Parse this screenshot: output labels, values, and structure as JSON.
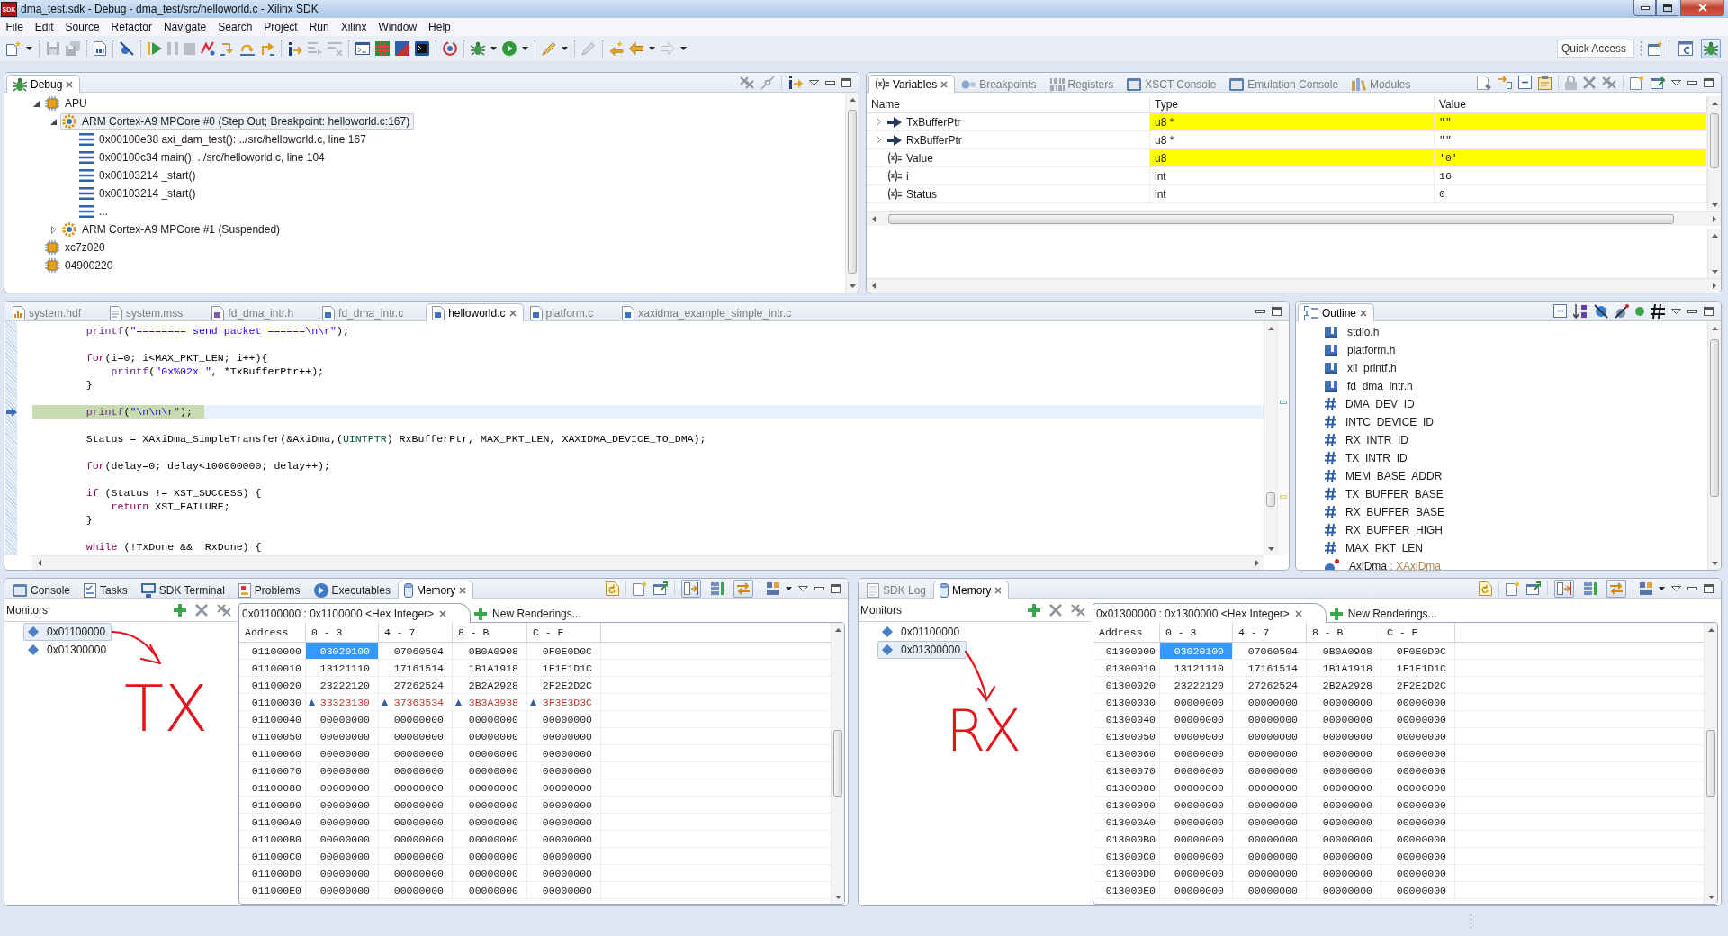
{
  "window": {
    "icon_text": "SDK",
    "title": "dma_test.sdk - Debug - dma_test/src/helloworld.c - Xilinx SDK"
  },
  "menu": [
    "File",
    "Edit",
    "Source",
    "Refactor",
    "Navigate",
    "Search",
    "Project",
    "Run",
    "Xilinx",
    "Window",
    "Help"
  ],
  "quick_access": {
    "placeholder": "Quick Access"
  },
  "perspectives": [
    {
      "kind": "cpp",
      "selected": false
    },
    {
      "kind": "debug",
      "selected": true
    }
  ],
  "debug_view": {
    "tab": "Debug",
    "tree": [
      {
        "label": "APU",
        "kind": "target",
        "expanded": true,
        "selected": false,
        "children": [
          {
            "label": "ARM Cortex-A9 MPCore #0 (Step Out; Breakpoint: helloworld.c:167)",
            "kind": "core",
            "expanded": true,
            "selected": true,
            "children": [
              {
                "label": "0x00100e38 axi_dam_test(): ../src/helloworld.c, line 167",
                "kind": "frame",
                "selected": false
              },
              {
                "label": "0x00100c34 main(): ../src/helloworld.c, line 104",
                "kind": "frame",
                "selected": false
              },
              {
                "label": "0x00103214 _start()",
                "kind": "frame",
                "selected": false
              },
              {
                "label": "0x00103214 _start()",
                "kind": "frame",
                "selected": false
              },
              {
                "label": "...",
                "kind": "frame",
                "selected": false
              }
            ]
          },
          {
            "label": "ARM Cortex-A9 MPCore #1 (Suspended)",
            "kind": "core",
            "expanded": false,
            "selected": false
          }
        ]
      },
      {
        "label": "xc7z020",
        "kind": "target",
        "selected": false
      },
      {
        "label": "04900220",
        "kind": "target",
        "selected": false
      }
    ]
  },
  "variables_view": {
    "focused": false,
    "tabs": [
      {
        "label": "Variables",
        "kind": "variables",
        "selected": true
      },
      {
        "label": "Breakpoints",
        "kind": "breakpoints",
        "selected": false
      },
      {
        "label": "Registers",
        "kind": "registers",
        "selected": false
      },
      {
        "label": "XSCT Console",
        "kind": "console",
        "selected": false
      },
      {
        "label": "Emulation Console",
        "kind": "console",
        "selected": false
      },
      {
        "label": "Modules",
        "kind": "modules",
        "selected": false
      }
    ],
    "columns": [
      "Name",
      "Type",
      "Value"
    ],
    "rows": [
      {
        "name": "TxBufferPtr",
        "type": "u8 *",
        "value": "\"\"",
        "kind": "pointer",
        "expanded": false,
        "changed": true
      },
      {
        "name": "RxBufferPtr",
        "type": "u8 *",
        "value": "\"\"",
        "kind": "pointer",
        "expanded": false,
        "changed": false
      },
      {
        "name": "Value",
        "type": "u8",
        "value": "'0'",
        "kind": "variable",
        "changed": true
      },
      {
        "name": "i",
        "type": "int",
        "value": "16",
        "kind": "variable",
        "changed": false
      },
      {
        "name": "Status",
        "type": "int",
        "value": "0",
        "kind": "variable",
        "changed": false
      }
    ]
  },
  "editor": {
    "focused": false,
    "tabs": [
      {
        "label": "system.hdf",
        "kind": "hdf",
        "selected": false
      },
      {
        "label": "system.mss",
        "kind": "mss",
        "selected": false
      },
      {
        "label": "fd_dma_intr.h",
        "kind": "h",
        "selected": false
      },
      {
        "label": "fd_dma_intr.c",
        "kind": "c",
        "selected": false
      },
      {
        "label": "helloworld.c",
        "kind": "c",
        "selected": true
      },
      {
        "label": "platform.c",
        "kind": "c",
        "selected": false
      },
      {
        "label": "xaxidma_example_simple_intr.c",
        "kind": "c",
        "selected": false
      }
    ],
    "lines": [
      {
        "current": false,
        "tokens": [
          {
            "text": "\t\tprintf",
            "kind": "function"
          },
          {
            "text": "(",
            "kind": "plain"
          },
          {
            "text": "\"======== send packet ======\\n\\r\"",
            "kind": "string"
          },
          {
            "text": ");",
            "kind": "plain"
          }
        ]
      },
      {
        "current": false
      },
      {
        "current": false,
        "tokens": [
          {
            "text": "\t\tfor",
            "kind": "keyword"
          },
          {
            "text": "(i=0; i<MAX_PKT_LEN; i++){",
            "kind": "plain"
          }
        ]
      },
      {
        "current": false,
        "tokens": [
          {
            "text": "\t\t\tprintf",
            "kind": "function"
          },
          {
            "text": "(",
            "kind": "plain"
          },
          {
            "text": "\"0x%02x \"",
            "kind": "string"
          },
          {
            "text": ", *TxBufferPtr++);",
            "kind": "plain"
          }
        ]
      },
      {
        "current": false,
        "tokens": [
          {
            "text": "\t\t}",
            "kind": "plain"
          }
        ]
      },
      {
        "current": false
      },
      {
        "current": true,
        "tokens": [
          {
            "text": "\t\tprintf",
            "kind": "function"
          },
          {
            "text": "(",
            "kind": "plain"
          },
          {
            "text": "\"\\n\\n\\r\"",
            "kind": "string"
          },
          {
            "text": ");",
            "kind": "plain"
          }
        ]
      },
      {
        "current": false
      },
      {
        "current": false,
        "tokens": [
          {
            "text": "\t\tStatus = XAxiDma_SimpleTransfer(&AxiDma,(",
            "kind": "plain"
          },
          {
            "text": "UINTPTR",
            "kind": "type"
          },
          {
            "text": ") RxBufferPtr, MAX_PKT_LEN, XAXIDMA_DEVICE_TO_DMA);",
            "kind": "plain"
          }
        ]
      },
      {
        "current": false
      },
      {
        "current": false,
        "tokens": [
          {
            "text": "\t\tfor",
            "kind": "keyword"
          },
          {
            "text": "(delay=0; delay<100000000; delay++);",
            "kind": "plain"
          }
        ]
      },
      {
        "current": false
      },
      {
        "current": false,
        "tokens": [
          {
            "text": "\t\tif",
            "kind": "keyword"
          },
          {
            "text": " (Status != XST_SUCCESS) {",
            "kind": "plain"
          }
        ]
      },
      {
        "current": false,
        "tokens": [
          {
            "text": "\t\t\treturn",
            "kind": "keyword"
          },
          {
            "text": " XST_FAILURE;",
            "kind": "plain"
          }
        ]
      },
      {
        "current": false,
        "tokens": [
          {
            "text": "\t\t}",
            "kind": "plain"
          }
        ]
      },
      {
        "current": false
      },
      {
        "current": false,
        "tokens": [
          {
            "text": "\t\twhile",
            "kind": "keyword"
          },
          {
            "text": " (!TxDone && !RxDone) {",
            "kind": "plain"
          }
        ]
      }
    ]
  },
  "outline": {
    "tab": "Outline",
    "items": [
      {
        "name": "stdio.h",
        "kind": "include"
      },
      {
        "name": "platform.h",
        "kind": "include"
      },
      {
        "name": "xil_printf.h",
        "kind": "include"
      },
      {
        "name": "fd_dma_intr.h",
        "kind": "include"
      },
      {
        "name": "DMA_DEV_ID",
        "kind": "macro"
      },
      {
        "name": "INTC_DEVICE_ID",
        "kind": "macro"
      },
      {
        "name": "RX_INTR_ID",
        "kind": "macro"
      },
      {
        "name": "TX_INTR_ID",
        "kind": "macro"
      },
      {
        "name": "MEM_BASE_ADDR",
        "kind": "macro"
      },
      {
        "name": "TX_BUFFER_BASE",
        "kind": "macro"
      },
      {
        "name": "RX_BUFFER_BASE",
        "kind": "macro"
      },
      {
        "name": "RX_BUFFER_HIGH",
        "kind": "macro"
      },
      {
        "name": "MAX_PKT_LEN",
        "kind": "macro"
      },
      {
        "name": "AxiDma",
        "decoration": ": XAxiDma",
        "kind": "static_variable"
      }
    ]
  },
  "memory_views": [
    {
      "focused": true,
      "tabs": [
        {
          "label": "Console",
          "kind": "console",
          "selected": false
        },
        {
          "label": "Tasks",
          "kind": "tasks",
          "selected": false
        },
        {
          "label": "SDK Terminal",
          "kind": "terminal",
          "selected": false
        },
        {
          "label": "Problems",
          "kind": "problems",
          "selected": false
        },
        {
          "label": "Executables",
          "kind": "executables",
          "selected": false
        },
        {
          "label": "Memory",
          "kind": "memory",
          "selected": true
        }
      ],
      "toggles": [
        {
          "on": true
        },
        {
          "on": false
        },
        {
          "on": true
        }
      ],
      "monitors_label": "Monitors",
      "monitors": [
        {
          "address": "0x01100000",
          "selected": true
        },
        {
          "address": "0x01300000",
          "selected": false
        }
      ],
      "rendering_tabs": [
        {
          "label": "0x01100000 : 0x1100000 <Hex Integer>",
          "kind": "rendering",
          "selected": true
        },
        {
          "label": "New Renderings...",
          "kind": "new",
          "selected": false
        }
      ],
      "address_header": "Address",
      "columns": [
        "0 - 3",
        "4 - 7",
        "8 - B",
        "C - F"
      ],
      "rows": [
        {
          "address": "01100000",
          "changed": false,
          "cells": [
            {
              "value": "03020100",
              "selected": true
            },
            {
              "value": "07060504",
              "selected": false
            },
            {
              "value": "0B0A0908",
              "selected": false
            },
            {
              "value": "0F0E0D0C",
              "selected": false
            }
          ]
        },
        {
          "address": "01100010",
          "changed": false,
          "cells": [
            {
              "value": "13121110",
              "selected": false
            },
            {
              "value": "17161514",
              "selected": false
            },
            {
              "value": "1B1A1918",
              "selected": false
            },
            {
              "value": "1F1E1D1C",
              "selected": false
            }
          ]
        },
        {
          "address": "01100020",
          "changed": false,
          "cells": [
            {
              "value": "23222120",
              "selected": false
            },
            {
              "value": "27262524",
              "selected": false
            },
            {
              "value": "2B2A2928",
              "selected": false
            },
            {
              "value": "2F2E2D2C",
              "selected": false
            }
          ]
        },
        {
          "address": "01100030",
          "changed": true,
          "cells": [
            {
              "value": "33323130",
              "selected": false
            },
            {
              "value": "37363534",
              "selected": false
            },
            {
              "value": "3B3A3938",
              "selected": false
            },
            {
              "value": "3F3E3D3C",
              "selected": false
            }
          ]
        },
        {
          "address": "01100040",
          "changed": false,
          "cells": [
            {
              "value": "00000000",
              "selected": false
            },
            {
              "value": "00000000",
              "selected": false
            },
            {
              "value": "00000000",
              "selected": false
            },
            {
              "value": "00000000",
              "selected": false
            }
          ]
        },
        {
          "address": "01100050",
          "changed": false,
          "cells": [
            {
              "value": "00000000",
              "selected": false
            },
            {
              "value": "00000000",
              "selected": false
            },
            {
              "value": "00000000",
              "selected": false
            },
            {
              "value": "00000000",
              "selected": false
            }
          ]
        },
        {
          "address": "01100060",
          "changed": false,
          "cells": [
            {
              "value": "00000000",
              "selected": false
            },
            {
              "value": "00000000",
              "selected": false
            },
            {
              "value": "00000000",
              "selected": false
            },
            {
              "value": "00000000",
              "selected": false
            }
          ]
        },
        {
          "address": "01100070",
          "changed": false,
          "cells": [
            {
              "value": "00000000",
              "selected": false
            },
            {
              "value": "00000000",
              "selected": false
            },
            {
              "value": "00000000",
              "selected": false
            },
            {
              "value": "00000000",
              "selected": false
            }
          ]
        },
        {
          "address": "01100080",
          "changed": false,
          "cells": [
            {
              "value": "00000000",
              "selected": false
            },
            {
              "value": "00000000",
              "selected": false
            },
            {
              "value": "00000000",
              "selected": false
            },
            {
              "value": "00000000",
              "selected": false
            }
          ]
        },
        {
          "address": "01100090",
          "changed": false,
          "cells": [
            {
              "value": "00000000",
              "selected": false
            },
            {
              "value": "00000000",
              "selected": false
            },
            {
              "value": "00000000",
              "selected": false
            },
            {
              "value": "00000000",
              "selected": false
            }
          ]
        },
        {
          "address": "011000A0",
          "changed": false,
          "cells": [
            {
              "value": "00000000",
              "selected": false
            },
            {
              "value": "00000000",
              "selected": false
            },
            {
              "value": "00000000",
              "selected": false
            },
            {
              "value": "00000000",
              "selected": false
            }
          ]
        },
        {
          "address": "011000B0",
          "changed": false,
          "cells": [
            {
              "value": "00000000",
              "selected": false
            },
            {
              "value": "00000000",
              "selected": false
            },
            {
              "value": "00000000",
              "selected": false
            },
            {
              "value": "00000000",
              "selected": false
            }
          ]
        },
        {
          "address": "011000C0",
          "changed": false,
          "cells": [
            {
              "value": "00000000",
              "selected": false
            },
            {
              "value": "00000000",
              "selected": false
            },
            {
              "value": "00000000",
              "selected": false
            },
            {
              "value": "00000000",
              "selected": false
            }
          ]
        },
        {
          "address": "011000D0",
          "changed": false,
          "cells": [
            {
              "value": "00000000",
              "selected": false
            },
            {
              "value": "00000000",
              "selected": false
            },
            {
              "value": "00000000",
              "selected": false
            },
            {
              "value": "00000000",
              "selected": false
            }
          ]
        },
        {
          "address": "011000E0",
          "changed": false,
          "cells": [
            {
              "value": "00000000",
              "selected": false
            },
            {
              "value": "00000000",
              "selected": false
            },
            {
              "value": "00000000",
              "selected": false
            },
            {
              "value": "00000000",
              "selected": false
            }
          ]
        }
      ],
      "annotation": {
        "text": "TX",
        "kind": "curve"
      }
    },
    {
      "focused": false,
      "tabs": [
        {
          "label": "SDK Log",
          "kind": "log",
          "selected": false
        },
        {
          "label": "Memory",
          "kind": "memory",
          "selected": true
        }
      ],
      "toggles": [
        {
          "on": true
        },
        {
          "on": false
        },
        {
          "on": true
        }
      ],
      "monitors_label": "Monitors",
      "monitors": [
        {
          "address": "0x01100000",
          "selected": false
        },
        {
          "address": "0x01300000",
          "selected": true
        }
      ],
      "rendering_tabs": [
        {
          "label": "0x01300000 : 0x1300000 <Hex Integer>",
          "kind": "rendering",
          "selected": true
        },
        {
          "label": "New Renderings...",
          "kind": "new",
          "selected": false
        }
      ],
      "address_header": "Address",
      "columns": [
        "0 - 3",
        "4 - 7",
        "8 - B",
        "C - F"
      ],
      "rows": [
        {
          "address": "01300000",
          "changed": false,
          "cells": [
            {
              "value": "03020100",
              "selected": true
            },
            {
              "value": "07060504",
              "selected": false
            },
            {
              "value": "0B0A0908",
              "selected": false
            },
            {
              "value": "0F0E0D0C",
              "selected": false
            }
          ]
        },
        {
          "address": "01300010",
          "changed": false,
          "cells": [
            {
              "value": "13121110",
              "selected": false
            },
            {
              "value": "17161514",
              "selected": false
            },
            {
              "value": "1B1A1918",
              "selected": false
            },
            {
              "value": "1F1E1D1C",
              "selected": false
            }
          ]
        },
        {
          "address": "01300020",
          "changed": false,
          "cells": [
            {
              "value": "23222120",
              "selected": false
            },
            {
              "value": "27262524",
              "selected": false
            },
            {
              "value": "2B2A2928",
              "selected": false
            },
            {
              "value": "2F2E2D2C",
              "selected": false
            }
          ]
        },
        {
          "address": "01300030",
          "changed": false,
          "cells": [
            {
              "value": "00000000",
              "selected": false
            },
            {
              "value": "00000000",
              "selected": false
            },
            {
              "value": "00000000",
              "selected": false
            },
            {
              "value": "00000000",
              "selected": false
            }
          ]
        },
        {
          "address": "01300040",
          "changed": false,
          "cells": [
            {
              "value": "00000000",
              "selected": false
            },
            {
              "value": "00000000",
              "selected": false
            },
            {
              "value": "00000000",
              "selected": false
            },
            {
              "value": "00000000",
              "selected": false
            }
          ]
        },
        {
          "address": "01300050",
          "changed": false,
          "cells": [
            {
              "value": "00000000",
              "selected": false
            },
            {
              "value": "00000000",
              "selected": false
            },
            {
              "value": "00000000",
              "selected": false
            },
            {
              "value": "00000000",
              "selected": false
            }
          ]
        },
        {
          "address": "01300060",
          "changed": false,
          "cells": [
            {
              "value": "00000000",
              "selected": false
            },
            {
              "value": "00000000",
              "selected": false
            },
            {
              "value": "00000000",
              "selected": false
            },
            {
              "value": "00000000",
              "selected": false
            }
          ]
        },
        {
          "address": "01300070",
          "changed": false,
          "cells": [
            {
              "value": "00000000",
              "selected": false
            },
            {
              "value": "00000000",
              "selected": false
            },
            {
              "value": "00000000",
              "selected": false
            },
            {
              "value": "00000000",
              "selected": false
            }
          ]
        },
        {
          "address": "01300080",
          "changed": false,
          "cells": [
            {
              "value": "00000000",
              "selected": false
            },
            {
              "value": "00000000",
              "selected": false
            },
            {
              "value": "00000000",
              "selected": false
            },
            {
              "value": "00000000",
              "selected": false
            }
          ]
        },
        {
          "address": "01300090",
          "changed": false,
          "cells": [
            {
              "value": "00000000",
              "selected": false
            },
            {
              "value": "00000000",
              "selected": false
            },
            {
              "value": "00000000",
              "selected": false
            },
            {
              "value": "00000000",
              "selected": false
            }
          ]
        },
        {
          "address": "013000A0",
          "changed": false,
          "cells": [
            {
              "value": "00000000",
              "selected": false
            },
            {
              "value": "00000000",
              "selected": false
            },
            {
              "value": "00000000",
              "selected": false
            },
            {
              "value": "00000000",
              "selected": false
            }
          ]
        },
        {
          "address": "013000B0",
          "changed": false,
          "cells": [
            {
              "value": "00000000",
              "selected": false
            },
            {
              "value": "00000000",
              "selected": false
            },
            {
              "value": "00000000",
              "selected": false
            },
            {
              "value": "00000000",
              "selected": false
            }
          ]
        },
        {
          "address": "013000C0",
          "changed": false,
          "cells": [
            {
              "value": "00000000",
              "selected": false
            },
            {
              "value": "00000000",
              "selected": false
            },
            {
              "value": "00000000",
              "selected": false
            },
            {
              "value": "00000000",
              "selected": false
            }
          ]
        },
        {
          "address": "013000D0",
          "changed": false,
          "cells": [
            {
              "value": "00000000",
              "selected": false
            },
            {
              "value": "00000000",
              "selected": false
            },
            {
              "value": "00000000",
              "selected": false
            },
            {
              "value": "00000000",
              "selected": false
            }
          ]
        },
        {
          "address": "013000E0",
          "changed": false,
          "cells": [
            {
              "value": "00000000",
              "selected": false
            },
            {
              "value": "00000000",
              "selected": false
            },
            {
              "value": "00000000",
              "selected": false
            },
            {
              "value": "00000000",
              "selected": false
            }
          ]
        }
      ],
      "annotation": {
        "text": "RX",
        "kind": "down"
      }
    }
  ]
}
